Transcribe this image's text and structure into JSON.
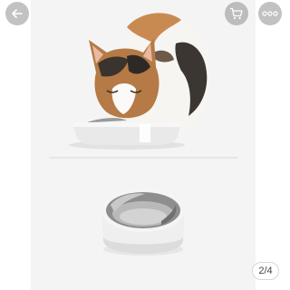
{
  "header": {
    "back_icon": "arrow-left-icon",
    "cart_icon": "shopping-cart-icon",
    "more_icon": "more-horizontal-icon"
  },
  "gallery": {
    "page_indicator": "2/4",
    "images": [
      "cat-eating-from-bowl-photo",
      "stainless-steel-bowl-photo"
    ]
  },
  "colors": {
    "header_button_bg": "#8a8a8a",
    "panel_bg": "#f4f4f4"
  }
}
